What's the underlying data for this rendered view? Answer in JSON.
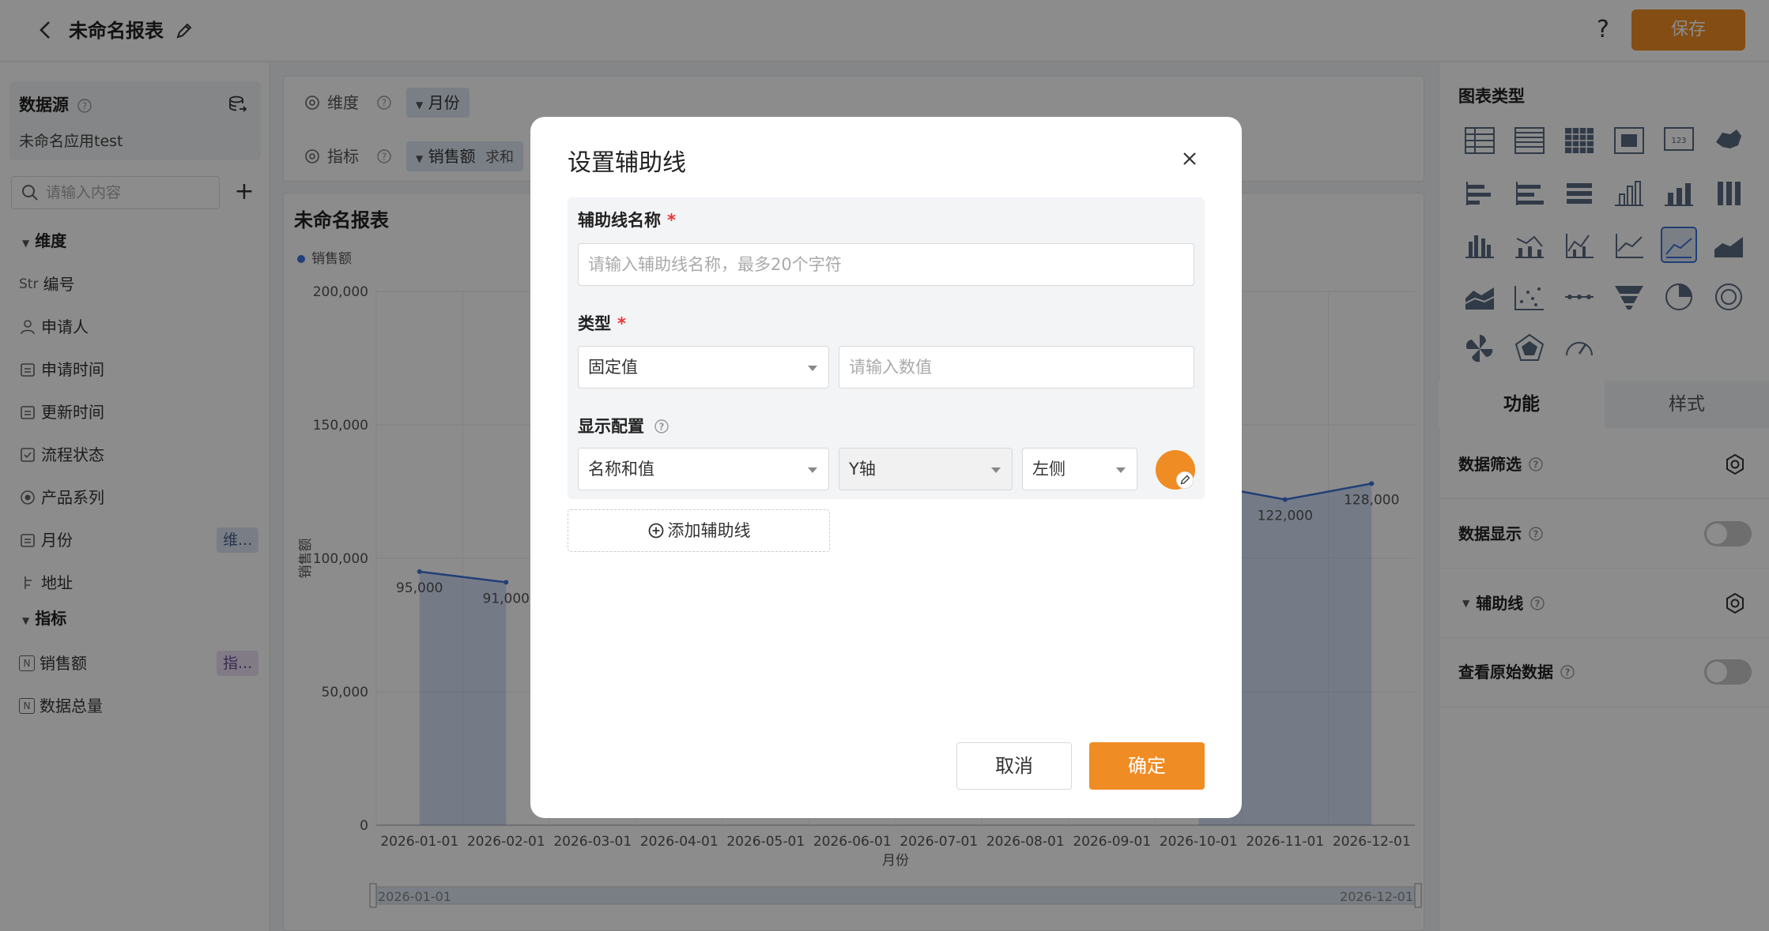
{
  "header": {
    "title": "未命名报表",
    "help": "?",
    "save_label": "保存"
  },
  "sidebar": {
    "datasource_title": "数据源",
    "app_name": "未命名应用test",
    "search_placeholder": "请输入内容",
    "add": "+",
    "dimension_title": "维度",
    "dimension_fields": [
      {
        "type": "Str",
        "label": "编号"
      },
      {
        "type": "person",
        "label": "申请人"
      },
      {
        "type": "date",
        "label": "申请时间"
      },
      {
        "type": "date",
        "label": "更新时间"
      },
      {
        "type": "check",
        "label": "流程状态"
      },
      {
        "type": "radio",
        "label": "产品系列"
      },
      {
        "type": "date",
        "label": "月份",
        "tag": "维..."
      },
      {
        "type": "geo",
        "label": "地址"
      }
    ],
    "metric_title": "指标",
    "metric_fields": [
      {
        "type": "N",
        "label": "销售额",
        "tag": "指..."
      },
      {
        "type": "N",
        "label": "数据总量"
      }
    ]
  },
  "config": {
    "dimension_label": "维度",
    "dimension_value": "月份",
    "metric_label": "指标",
    "metric_value": "销售额",
    "metric_agg": "求和"
  },
  "chart": {
    "title": "未命名报表",
    "legend": "销售额"
  },
  "chart_data": {
    "type": "area",
    "categories": [
      "2026-01-01",
      "2026-02-01",
      "2026-03-01",
      "2026-04-01",
      "2026-05-01",
      "2026-06-01",
      "2026-07-01",
      "2026-08-01",
      "2026-09-01",
      "2026-10-01",
      "2026-11-01",
      "2026-12-01"
    ],
    "series": [
      {
        "name": "销售额",
        "values": [
          95000,
          91000,
          null,
          null,
          null,
          null,
          null,
          null,
          null,
          128000,
          122000,
          128000
        ]
      }
    ],
    "visible_labels": {
      "2026-01-01": "95,000",
      "2026-02-01": "91,000",
      "2026-11-01": "122,000",
      "2026-12-01": "128,000"
    },
    "yticks": [
      "0",
      "50,000",
      "100,000",
      "150,000",
      "200,000"
    ],
    "ylim": [
      0,
      200000
    ],
    "ylabel": "销售额",
    "xlabel": "月份",
    "slider_start": "2026-01-01",
    "slider_end": "2026-12-01",
    "color": "#3d74d8"
  },
  "right_panel": {
    "chart_types_title": "图表类型",
    "tab_function": "功能",
    "tab_style": "样式",
    "rows": {
      "filter": "数据筛选",
      "display": "数据显示",
      "aux_line": "辅助线",
      "raw": "查看原始数据"
    }
  },
  "modal": {
    "title": "设置辅助线",
    "name_label": "辅助线名称",
    "name_placeholder": "请输入辅助线名称，最多20个字符",
    "type_label": "类型",
    "type_value": "固定值",
    "value_placeholder": "请输入数值",
    "display_label": "显示配置",
    "display_value": "名称和值",
    "axis_value": "Y轴",
    "side_value": "左侧",
    "add_line": "添加辅助线",
    "cancel": "取消",
    "confirm": "确定",
    "required_mark": "*",
    "line_color": "#f08c24"
  }
}
